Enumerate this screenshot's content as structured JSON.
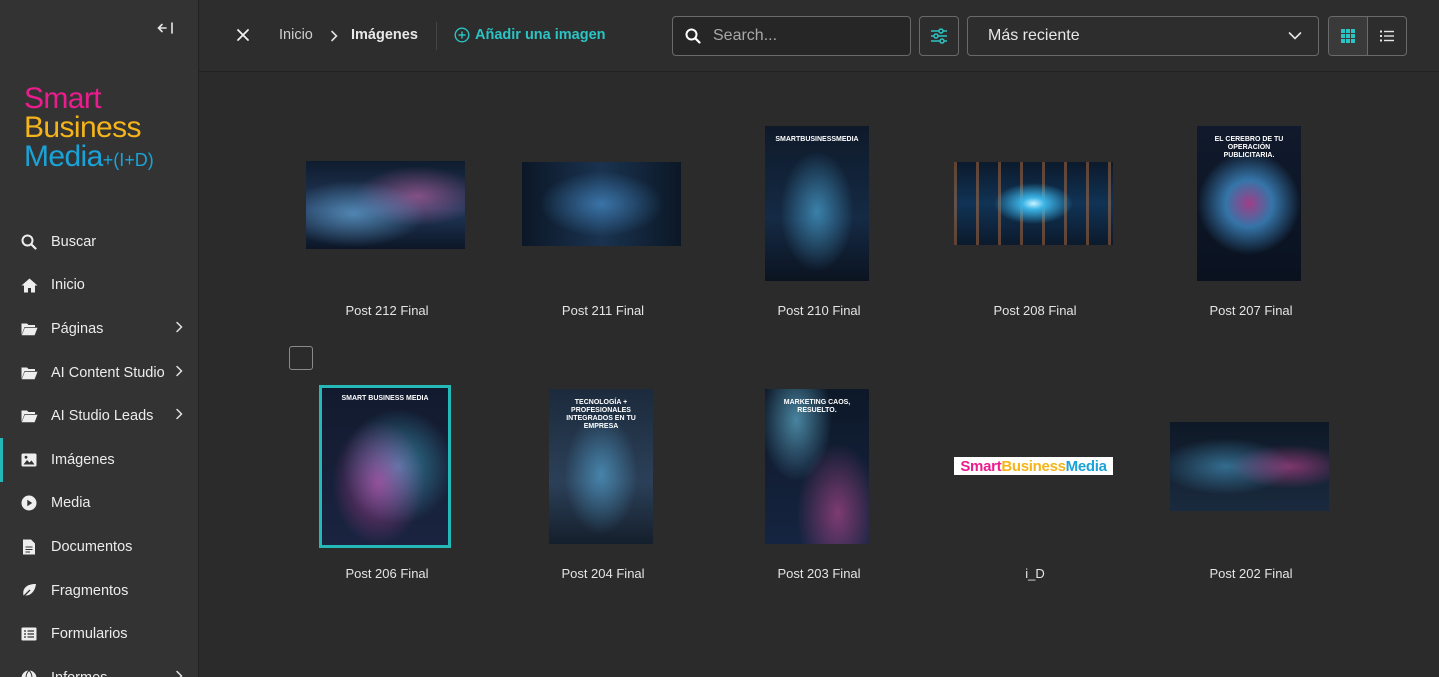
{
  "sidebar": {
    "logo": {
      "line1": "Smart",
      "line2": "Business",
      "line3": "Media",
      "suffix": "+(I+D)"
    },
    "items": [
      {
        "label": "Buscar",
        "icon": "search-icon",
        "has_children": false,
        "active": false
      },
      {
        "label": "Inicio",
        "icon": "home-icon",
        "has_children": false,
        "active": false
      },
      {
        "label": "Páginas",
        "icon": "folder-icon",
        "has_children": true,
        "active": false
      },
      {
        "label": "AI Content Studio",
        "icon": "folder-icon",
        "has_children": true,
        "active": false
      },
      {
        "label": "AI Studio Leads",
        "icon": "folder-icon",
        "has_children": true,
        "active": false
      },
      {
        "label": "Imágenes",
        "icon": "image-icon",
        "has_children": false,
        "active": true
      },
      {
        "label": "Media",
        "icon": "play-icon",
        "has_children": false,
        "active": false
      },
      {
        "label": "Documentos",
        "icon": "document-icon",
        "has_children": false,
        "active": false
      },
      {
        "label": "Fragmentos",
        "icon": "leaf-icon",
        "has_children": false,
        "active": false
      },
      {
        "label": "Formularios",
        "icon": "form-icon",
        "has_children": false,
        "active": false
      },
      {
        "label": "Informes",
        "icon": "globe-icon",
        "has_children": true,
        "active": false
      }
    ]
  },
  "header": {
    "breadcrumb_home": "Inicio",
    "breadcrumb_current": "Imágenes",
    "add_image_label": "Añadir una imagen",
    "search_placeholder": "Search...",
    "sort_selected": "Más reciente"
  },
  "images": [
    {
      "caption": "Post 212 Final",
      "art": "art-city"
    },
    {
      "caption": "Post 211 Final",
      "art": "art-room"
    },
    {
      "caption": "Post 210 Final",
      "art": "art-poster",
      "poster_title": "SMARTBUSINESSMEDIA"
    },
    {
      "caption": "Post 208 Final",
      "art": "art-tunnel"
    },
    {
      "caption": "Post 207 Final",
      "art": "art-brain",
      "poster_title": "EL CEREBRO DE TU OPERACIÓN PUBLICITARIA."
    },
    {
      "caption": "Post 206 Final",
      "art": "art-pink",
      "poster_title": "SMART BUSINESS MEDIA",
      "selected": true
    },
    {
      "caption": "Post 204 Final",
      "art": "art-people",
      "poster_title": "TECNOLOGÍA + PROFESIONALES INTEGRADOS EN TU EMPRESA"
    },
    {
      "caption": "Post 203 Final",
      "art": "art-cloud",
      "poster_title": "MARKETING CAOS, RESUELTO."
    },
    {
      "caption": "i_D",
      "art": "logo-thumb",
      "logo_text": "SmartBusinessMedia"
    },
    {
      "caption": "Post 202 Final",
      "art": "art-lab"
    }
  ],
  "colors": {
    "accent": "#25b8b8",
    "logo_pink": "#ec1c8e",
    "logo_yellow": "#f5b51a",
    "logo_blue": "#1aa3d8"
  }
}
